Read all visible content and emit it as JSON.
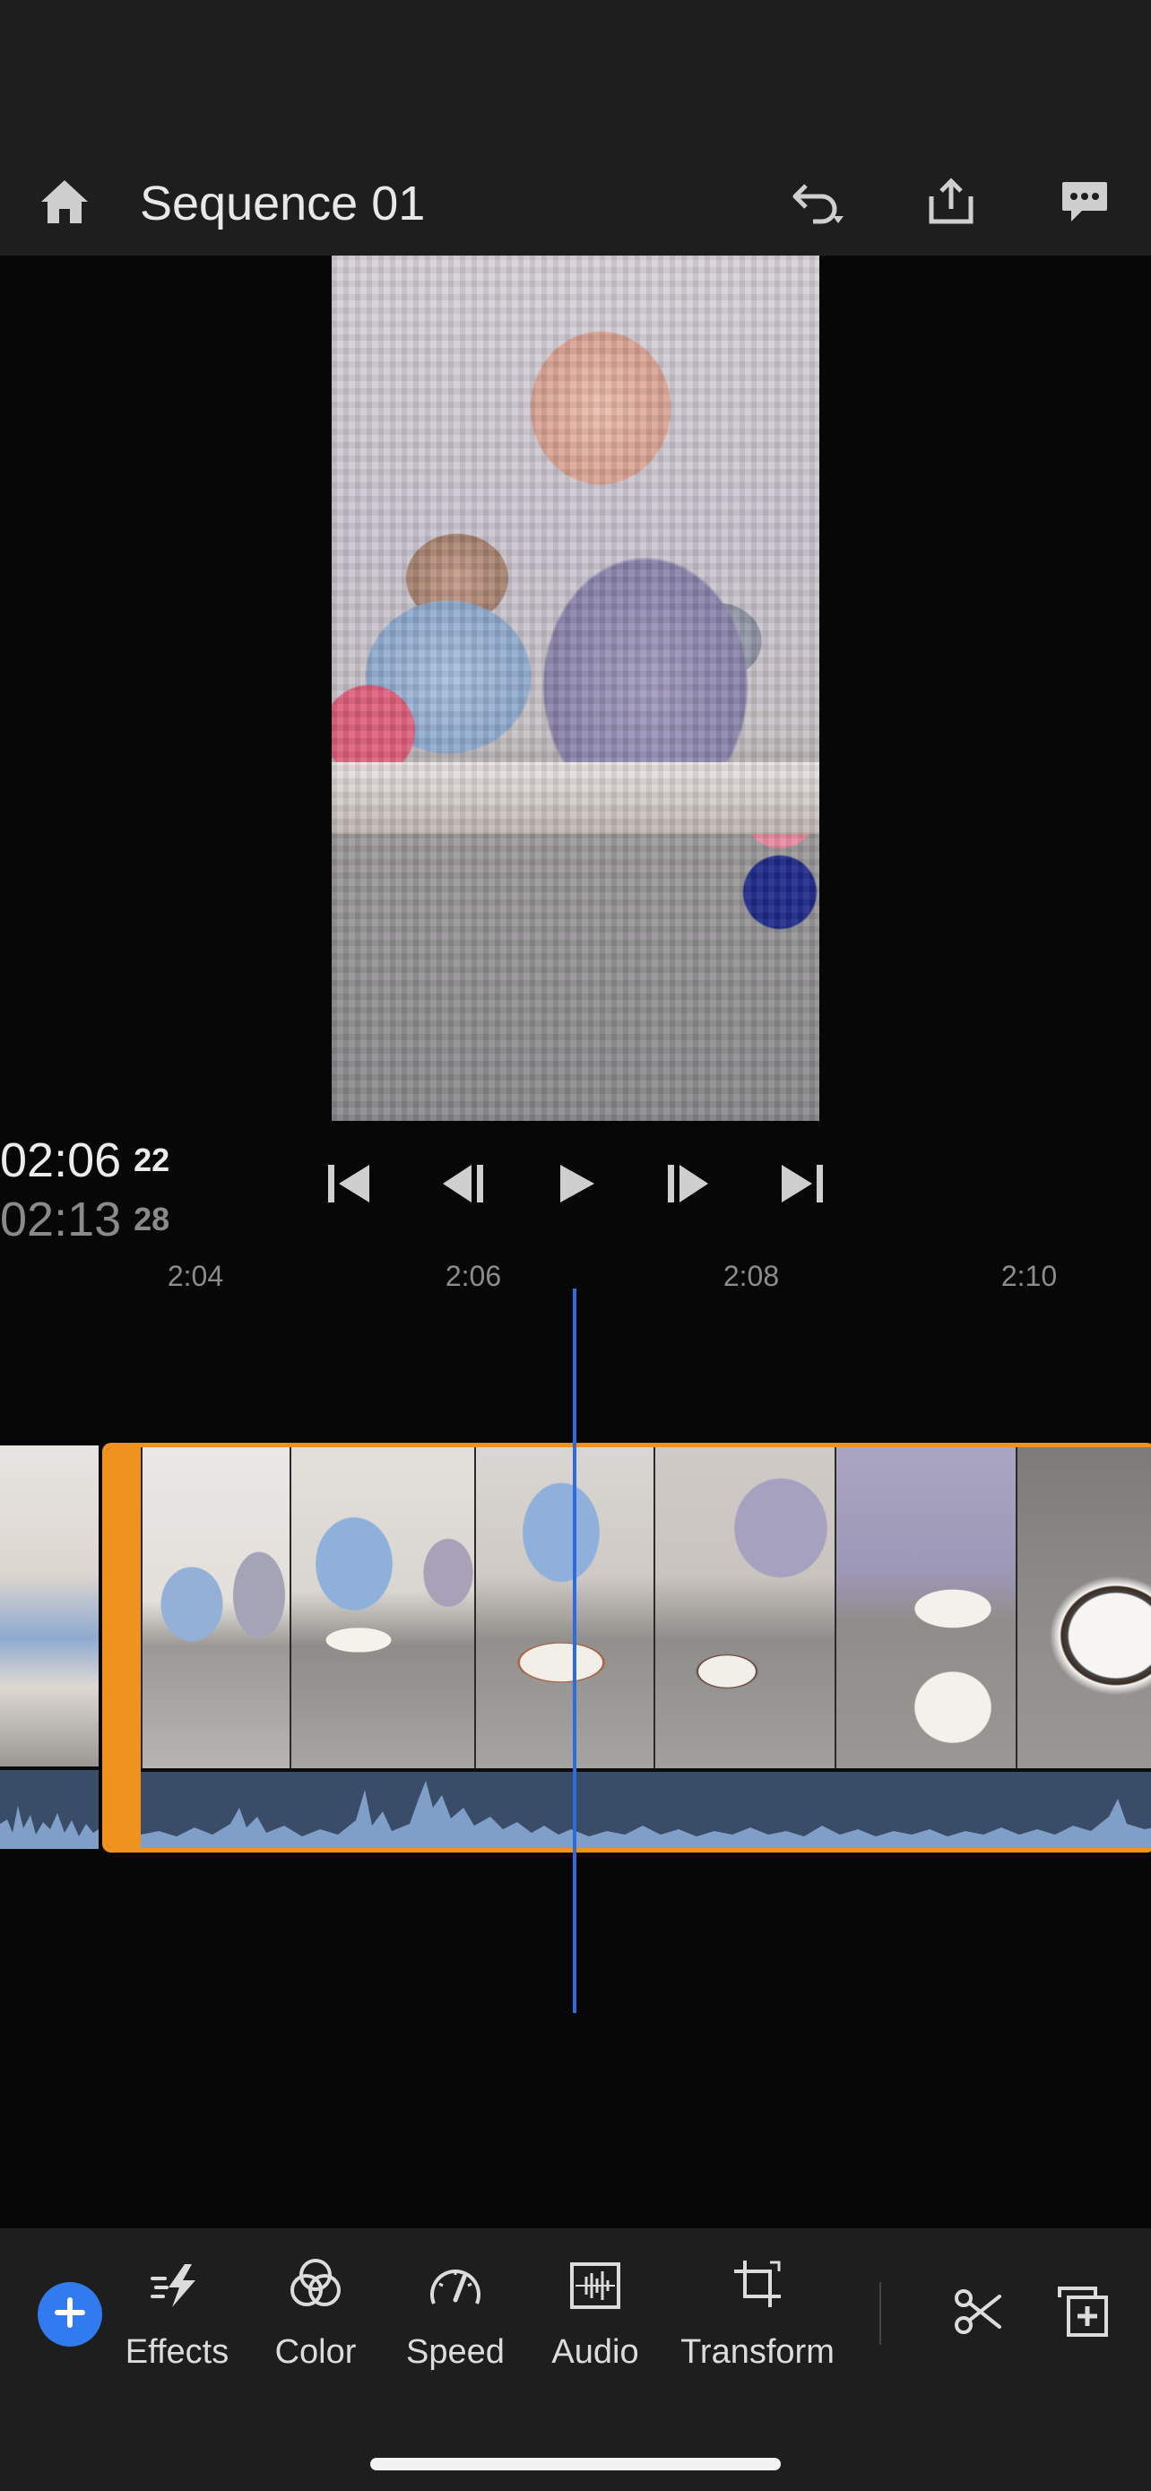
{
  "header": {
    "title": "Sequence 01",
    "icons": [
      "home-icon",
      "undo-icon",
      "share-icon",
      "feedback-icon"
    ]
  },
  "preview": {
    "description_icons": []
  },
  "timecode": {
    "current": "02:06",
    "current_frames": "22",
    "total": "02:13",
    "total_frames": "28"
  },
  "transport": {
    "icons": [
      "skip-to-start-icon",
      "step-back-icon",
      "play-icon",
      "step-forward-icon",
      "skip-to-end-icon"
    ]
  },
  "ruler": {
    "labels": [
      "2:04",
      "2:06",
      "2:08",
      "2:10"
    ]
  },
  "toolbar": {
    "tools": [
      {
        "label": "Effects",
        "icon": "effects-icon"
      },
      {
        "label": "Color",
        "icon": "color-icon"
      },
      {
        "label": "Speed",
        "icon": "speed-icon"
      },
      {
        "label": "Audio",
        "icon": "audio-icon"
      },
      {
        "label": "Transform",
        "icon": "transform-icon"
      }
    ],
    "side_icons": [
      "split-icon",
      "duplicate-icon"
    ],
    "colors": {
      "accent": "#2f7bef",
      "selection": "#f0931e",
      "playhead": "#2d6cdb"
    }
  }
}
